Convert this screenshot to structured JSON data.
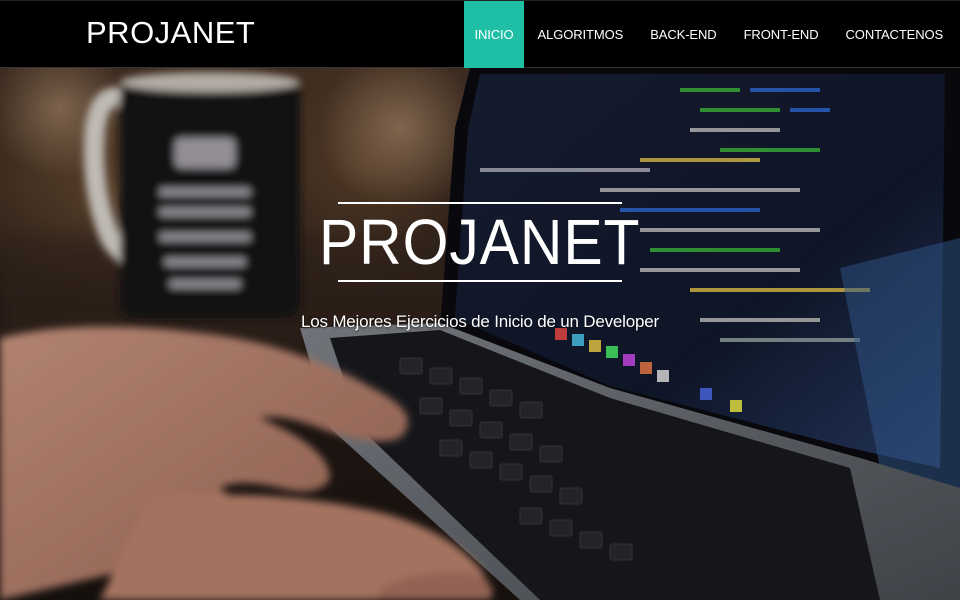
{
  "navbar": {
    "brand": "PROJANET",
    "items": [
      {
        "label": "INICIO",
        "active": true
      },
      {
        "label": "ALGORITMOS",
        "active": false
      },
      {
        "label": "BACK-END",
        "active": false
      },
      {
        "label": "FRONT-END",
        "active": false
      },
      {
        "label": "CONTACTENOS",
        "active": false
      }
    ]
  },
  "hero": {
    "title": "PROJANET",
    "subtitle": "Los Mejores Ejercicios de Inicio de un Developer",
    "background_image": "coffee-mug-and-laptop-with-code-photo"
  },
  "colors": {
    "navbar_bg": "#000000",
    "active_nav_bg": "#1fbfa6",
    "text": "#ffffff"
  }
}
